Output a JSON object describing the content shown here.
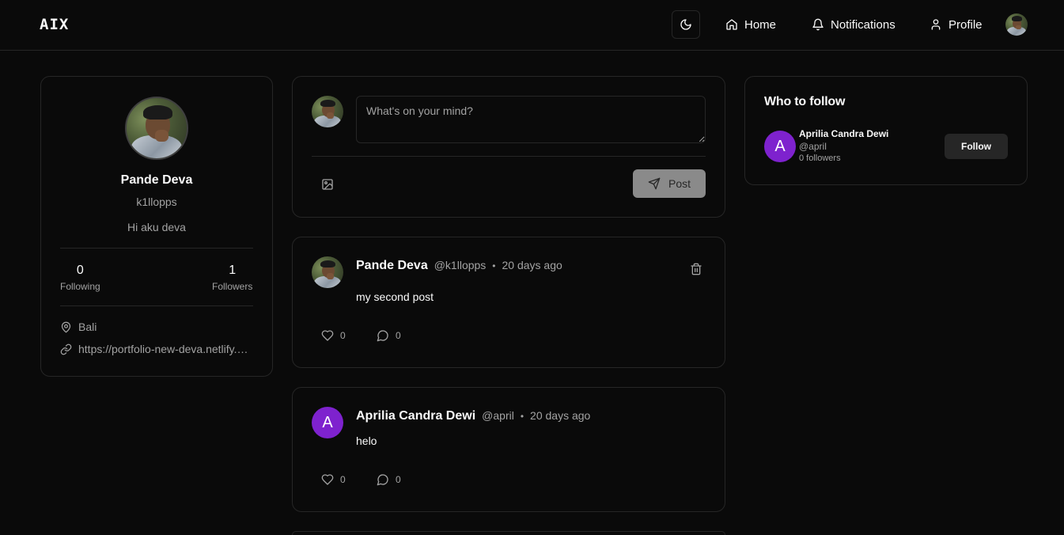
{
  "nav": {
    "logo": "AIX",
    "home_label": "Home",
    "notifications_label": "Notifications",
    "profile_label": "Profile"
  },
  "profile": {
    "name": "Pande Deva",
    "username": "k1llopps",
    "bio": "Hi aku deva",
    "following_count": "0",
    "following_label": "Following",
    "followers_count": "1",
    "followers_label": "Followers",
    "location": "Bali",
    "website": "https://portfolio-new-deva.netlify.app"
  },
  "composer": {
    "placeholder": "What's on your mind?",
    "post_label": "Post"
  },
  "posts": [
    {
      "author": "Pande Deva",
      "handle": "@k1llopps",
      "separator": "•",
      "time": "20 days ago",
      "content": "my second post",
      "likes": "0",
      "comments": "0"
    },
    {
      "author": "Aprilia Candra Dewi",
      "avatar_letter": "A",
      "handle": "@april",
      "separator": "•",
      "time": "20 days ago",
      "content": "helo",
      "likes": "0",
      "comments": "0"
    }
  ],
  "who_to_follow": {
    "title": "Who to follow",
    "users": [
      {
        "name": "Aprilia Candra Dewi",
        "avatar_letter": "A",
        "handle": "@april",
        "followers": "0 followers",
        "follow_label": "Follow"
      }
    ]
  },
  "colors": {
    "background": "#0a0a0a",
    "border": "#262626",
    "muted_text": "#a3a3a3",
    "avatar_purple": "#7e22ce",
    "post_button": "#8a8a8a"
  },
  "icons": [
    "moon-icon",
    "home-icon",
    "bell-icon",
    "user-icon",
    "map-pin-icon",
    "link-icon",
    "image-icon",
    "send-icon",
    "trash-icon",
    "heart-icon",
    "message-circle-icon"
  ]
}
